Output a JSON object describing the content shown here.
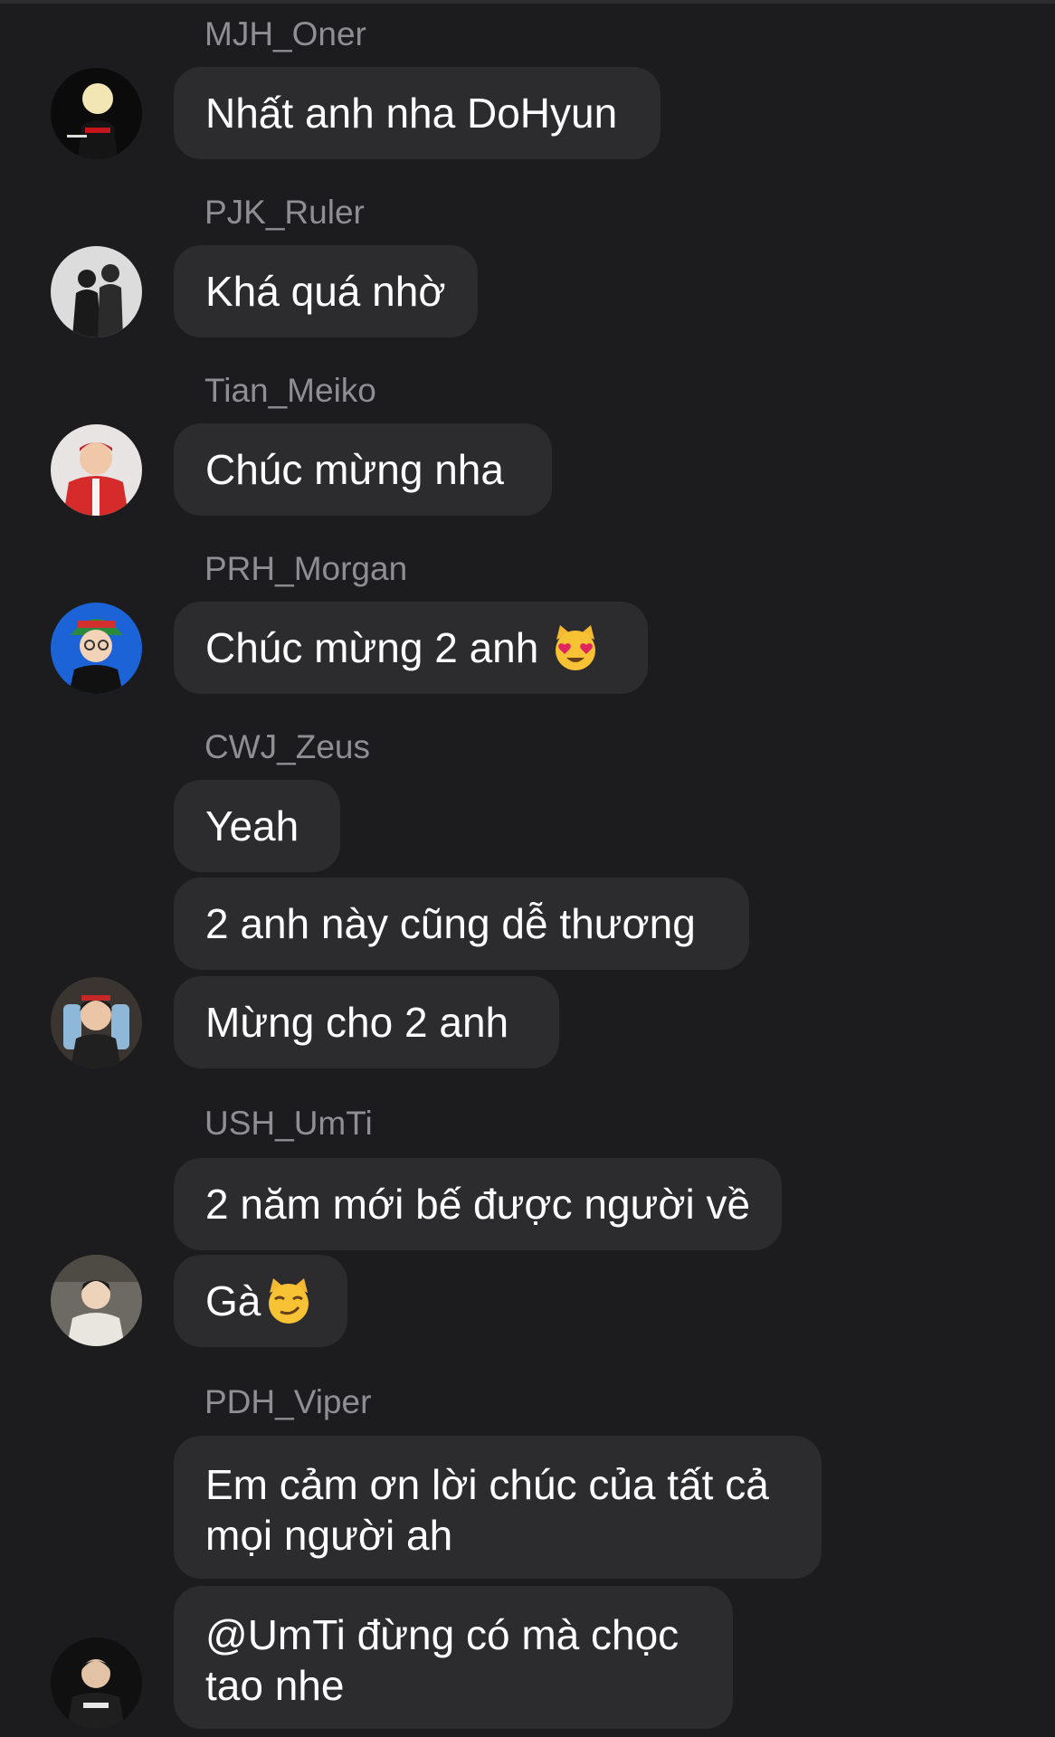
{
  "messages": [
    {
      "sender": "MJH_Oner",
      "avatar": "avatar-mjh-oner",
      "bubbles": [
        {
          "text": "Nhất anh nha DoHyun"
        }
      ]
    },
    {
      "sender": "PJK_Ruler",
      "avatar": "avatar-pjk-ruler",
      "bubbles": [
        {
          "text": "Khá quá nhờ"
        }
      ]
    },
    {
      "sender": "Tian_Meiko",
      "avatar": "avatar-tian-meiko",
      "bubbles": [
        {
          "text": "Chúc mừng nha"
        }
      ]
    },
    {
      "sender": "PRH_Morgan",
      "avatar": "avatar-prh-morgan",
      "bubbles": [
        {
          "text": "Chúc mừng 2 anh",
          "emoji": "heart-eyes-cat-emoji"
        }
      ]
    },
    {
      "sender": "CWJ_Zeus",
      "avatar": "avatar-cwj-zeus",
      "bubbles": [
        {
          "text": "Yeah"
        },
        {
          "text": "2 anh này cũng dễ thương"
        },
        {
          "text": "Mừng cho 2 anh"
        }
      ]
    },
    {
      "sender": "USH_UmTi",
      "avatar": "avatar-ush-umti",
      "bubbles": [
        {
          "text": "2 năm mới bế được người về"
        },
        {
          "text": "Gà",
          "emoji": "smirk-cat-emoji"
        }
      ]
    },
    {
      "sender": "PDH_Viper",
      "avatar": "avatar-pdh-viper",
      "bubbles": [
        {
          "text": "Em cảm ơn lời chúc của tất cả mọi người ah"
        },
        {
          "text": "@UmTi đừng có mà chọc tao nhe"
        }
      ]
    }
  ],
  "colors": {
    "background": "#1c1c1e",
    "bubble": "#2c2c2e",
    "sender_name": "#8e8e93",
    "message_text": "#ffffff"
  }
}
